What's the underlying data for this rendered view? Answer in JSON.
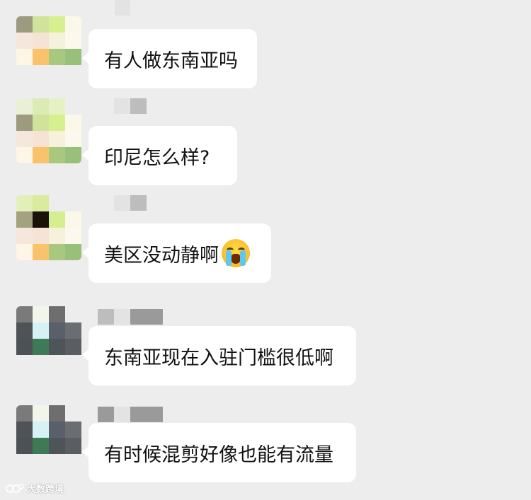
{
  "messages": [
    {
      "text": "有人做东南亚吗",
      "avatar_colors": [
        "#9c9a7f",
        "#cfe39a",
        "#d6ef8f",
        "#fbf8ea",
        "#f6e7dc",
        "#f7e3d6",
        "#f6f1da",
        "#fdf8ee",
        "#fdf5e6",
        "#f9c36b",
        "#a8c87f",
        "#98c07a",
        "#ededed",
        "#ededed",
        "#ededed",
        "#ededed"
      ],
      "name_colors": []
    },
    {
      "text": "印尼怎么样?",
      "avatar_colors": [
        "#e9f0d6",
        "#dcebb4",
        "#e6f1c3",
        "#ededed",
        "#9c9a7f",
        "#cfe39a",
        "#d6ef8f",
        "#fbf8ea",
        "#f6e7dc",
        "#f7e3d6",
        "#f6f1da",
        "#fdf8ee",
        "#fdf5e6",
        "#f9c36b",
        "#a8c87f",
        "#98c07a"
      ],
      "name_colors": [
        "#e3e3e3",
        "#bdbdbd"
      ]
    },
    {
      "text": "美区没动静啊",
      "emoji": "crying-face",
      "avatar_colors": [
        "#e3efb9",
        "#d9ec9e",
        "#ededed",
        "#ededed",
        "#a3a27f",
        "#1a130b",
        "#d5ee90",
        "#fbf8ea",
        "#f6e7dc",
        "#f7e3d6",
        "#f6f1da",
        "#fdf8ee",
        "#fdf5e6",
        "#f9c36b",
        "#a8c87f",
        "#98c07a"
      ],
      "name_colors": [
        "#e3e3e3",
        "#bdbdbd"
      ]
    },
    {
      "text": "东南亚现在入驻门槛很低啊",
      "avatar_colors": [
        "#7a7a7a",
        "#f2f6ea",
        "#6e6e6e",
        "#ededed",
        "#4f5357",
        "#d6f2f5",
        "#59606a",
        "#6a6e73",
        "#4d5156",
        "#3d7a55",
        "#4f5458",
        "#5a5d61",
        "#ededed",
        "#ededed",
        "#ededed",
        "#ededed"
      ],
      "name_colors": [
        "#bdbdbd",
        "#e3e3e3",
        "#9a9a9a",
        "#9a9a9a"
      ]
    },
    {
      "text": "有时候混剪好像也能有流量",
      "avatar_colors": [
        "#7a7a7a",
        "#f2f6ea",
        "#6e6e6e",
        "#ededed",
        "#4f5357",
        "#d6f2f5",
        "#59606a",
        "#6a6e73",
        "#4d5156",
        "#3d7a55",
        "#4f5458",
        "#5a5d61",
        "#ededed",
        "#ededed",
        "#ededed",
        "#ededed"
      ],
      "name_colors": [
        "#9a9a9a",
        "#e3e3e3",
        "#9a9a9a",
        "#9a9a9a"
      ]
    }
  ],
  "watermark": {
    "text": "大数跨境"
  }
}
